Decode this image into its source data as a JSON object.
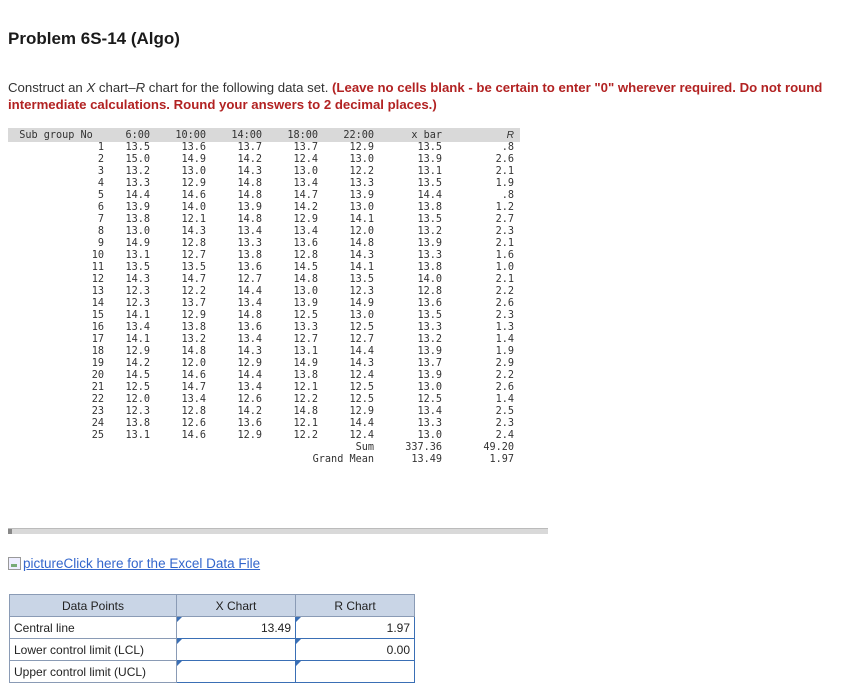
{
  "title": "Problem 6S-14 (Algo)",
  "instructions": {
    "prefix": "Construct an ",
    "chart_name": "X",
    "middle": " chart–",
    "r_name": "R",
    "suffix": " chart for the following data set. ",
    "bold": "(Leave no cells blank - be certain to enter \"0\" wherever required. Do not round intermediate calculations. Round your answers to 2 decimal places.)"
  },
  "data_table": {
    "headers": [
      "Sub group No",
      "6:00",
      "10:00",
      "14:00",
      "18:00",
      "22:00",
      "x bar",
      "R"
    ],
    "rows": [
      [
        "1",
        "13.5",
        "13.6",
        "13.7",
        "13.7",
        "12.9",
        "13.5",
        ".8"
      ],
      [
        "2",
        "15.0",
        "14.9",
        "14.2",
        "12.4",
        "13.0",
        "13.9",
        "2.6"
      ],
      [
        "3",
        "13.2",
        "13.0",
        "14.3",
        "13.0",
        "12.2",
        "13.1",
        "2.1"
      ],
      [
        "4",
        "13.3",
        "12.9",
        "14.8",
        "13.4",
        "13.3",
        "13.5",
        "1.9"
      ],
      [
        "5",
        "14.4",
        "14.6",
        "14.8",
        "14.7",
        "13.9",
        "14.4",
        ".8"
      ],
      [
        "6",
        "13.9",
        "14.0",
        "13.9",
        "14.2",
        "13.0",
        "13.8",
        "1.2"
      ],
      [
        "7",
        "13.8",
        "12.1",
        "14.8",
        "12.9",
        "14.1",
        "13.5",
        "2.7"
      ],
      [
        "8",
        "13.0",
        "14.3",
        "13.4",
        "13.4",
        "12.0",
        "13.2",
        "2.3"
      ],
      [
        "9",
        "14.9",
        "12.8",
        "13.3",
        "13.6",
        "14.8",
        "13.9",
        "2.1"
      ],
      [
        "10",
        "13.1",
        "12.7",
        "13.8",
        "12.8",
        "14.3",
        "13.3",
        "1.6"
      ],
      [
        "11",
        "13.5",
        "13.5",
        "13.6",
        "14.5",
        "14.1",
        "13.8",
        "1.0"
      ],
      [
        "12",
        "14.3",
        "14.7",
        "12.7",
        "14.8",
        "13.5",
        "14.0",
        "2.1"
      ],
      [
        "13",
        "12.3",
        "12.2",
        "14.4",
        "13.0",
        "12.3",
        "12.8",
        "2.2"
      ],
      [
        "14",
        "12.3",
        "13.7",
        "13.4",
        "13.9",
        "14.9",
        "13.6",
        "2.6"
      ],
      [
        "15",
        "14.1",
        "12.9",
        "14.8",
        "12.5",
        "13.0",
        "13.5",
        "2.3"
      ],
      [
        "16",
        "13.4",
        "13.8",
        "13.6",
        "13.3",
        "12.5",
        "13.3",
        "1.3"
      ],
      [
        "17",
        "14.1",
        "13.2",
        "13.4",
        "12.7",
        "12.7",
        "13.2",
        "1.4"
      ],
      [
        "18",
        "12.9",
        "14.8",
        "14.3",
        "13.1",
        "14.4",
        "13.9",
        "1.9"
      ],
      [
        "19",
        "14.2",
        "12.0",
        "12.9",
        "14.9",
        "14.3",
        "13.7",
        "2.9"
      ],
      [
        "20",
        "14.5",
        "14.6",
        "14.4",
        "13.8",
        "12.4",
        "13.9",
        "2.2"
      ],
      [
        "21",
        "12.5",
        "14.7",
        "13.4",
        "12.1",
        "12.5",
        "13.0",
        "2.6"
      ],
      [
        "22",
        "12.0",
        "13.4",
        "12.6",
        "12.2",
        "12.5",
        "12.5",
        "1.4"
      ],
      [
        "23",
        "12.3",
        "12.8",
        "14.2",
        "14.8",
        "12.9",
        "13.4",
        "2.5"
      ],
      [
        "24",
        "13.8",
        "12.6",
        "13.6",
        "12.1",
        "14.4",
        "13.3",
        "2.3"
      ],
      [
        "25",
        "13.1",
        "14.6",
        "12.9",
        "12.2",
        "12.4",
        "13.0",
        "2.4"
      ]
    ],
    "sum": {
      "label": "Sum",
      "xbar": "337.36",
      "r": "49.20"
    },
    "grand_mean": {
      "label": "Grand Mean",
      "xbar": "13.49",
      "r": "1.97"
    }
  },
  "excel_link": {
    "alt": "picture",
    "text": "Click here for the Excel Data File"
  },
  "answer_table": {
    "headers": [
      "Data Points",
      "X Chart",
      "R Chart"
    ],
    "rows": [
      {
        "label": "Central line",
        "x": "13.49",
        "r": "1.97"
      },
      {
        "label": "Lower control limit (LCL)",
        "x": "",
        "r": "0.00"
      },
      {
        "label": "Upper control limit (UCL)",
        "x": "",
        "r": ""
      }
    ]
  }
}
